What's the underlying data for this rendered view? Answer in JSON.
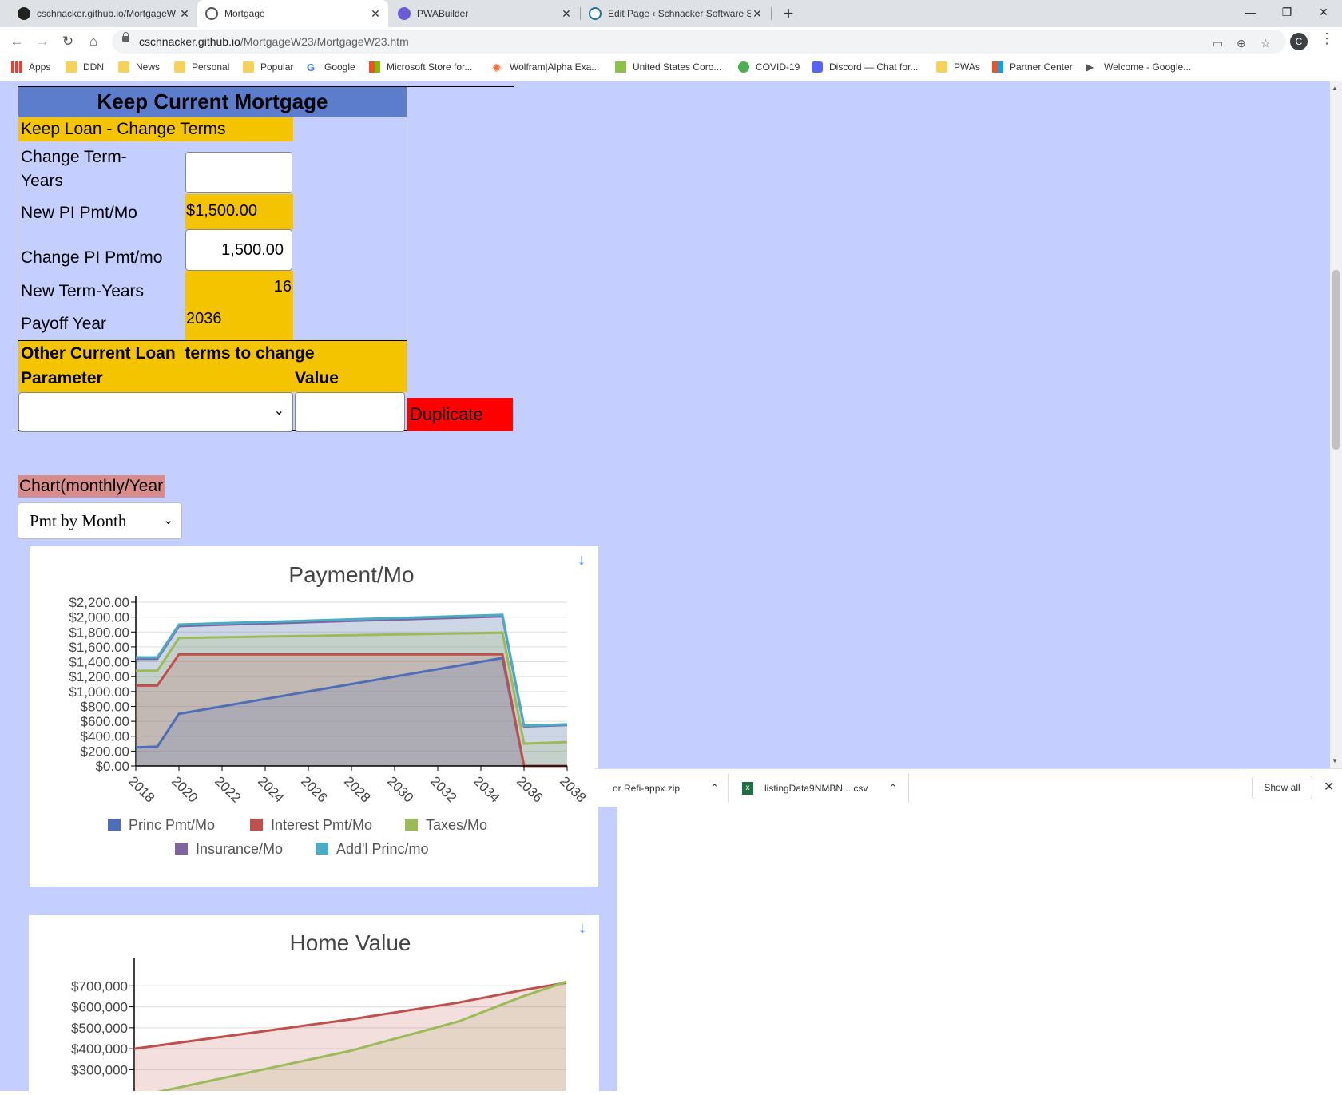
{
  "browser": {
    "tabs": [
      {
        "title": "cschnacker.github.io/MortgageW",
        "active": false
      },
      {
        "title": "Mortgage",
        "active": true
      },
      {
        "title": "PWABuilder",
        "active": false
      },
      {
        "title": "Edit Page ‹ Schnacker Software S",
        "active": false
      }
    ],
    "url_host": "cschnacker.github.io",
    "url_path": "/MortgageW23/MortgageW23.htm",
    "avatar_letter": "C",
    "bookmarks": [
      "Apps",
      "DDN",
      "News",
      "Personal",
      "Popular",
      "Google",
      "Microsoft Store for...",
      "Wolfram|Alpha Exa...",
      "United States Coro...",
      "COVID-19",
      "Discord — Chat for...",
      "PWAs",
      "Partner Center",
      "Welcome - Google..."
    ]
  },
  "panel": {
    "title": "Keep Current Mortgage",
    "subtitle": "Keep Loan - Change Terms",
    "change_term_label": "Change Term-\nYears",
    "change_term_value": "",
    "new_pi_label": "New PI Pmt/Mo",
    "new_pi_value": "$1,500.00",
    "change_pi_label": "Change PI Pmt/mo",
    "change_pi_value": "1,500.00",
    "new_term_label": "New Term-Years",
    "new_term_value": "16",
    "payoff_label": "Payoff Year",
    "payoff_value": "2036",
    "other_label": "Other Current Loan  terms to change",
    "param_header": "Parameter",
    "value_header": "Value",
    "param_selected": "",
    "value_input": "",
    "duplicate_label": "Duplicate"
  },
  "chart_controls": {
    "label": "Chart(monthly/Year",
    "selected": "Pmt by Month"
  },
  "chart_data": [
    {
      "type": "area",
      "title": "Payment/Mo",
      "x": [
        2018,
        2019,
        2020,
        2035,
        2036,
        2038
      ],
      "series": [
        {
          "name": "Princ Pmt/Mo",
          "color": "#4f6db8",
          "values": [
            250,
            260,
            700,
            1450,
            0,
            0
          ]
        },
        {
          "name": "Interest Pmt/Mo",
          "color": "#c0504d",
          "values": [
            1080,
            1080,
            1500,
            1500,
            0,
            0
          ]
        },
        {
          "name": "Taxes/Mo",
          "color": "#9bbb59",
          "values": [
            1280,
            1280,
            1720,
            1790,
            300,
            320
          ]
        },
        {
          "name": "Insurance/Mo",
          "color": "#8064a2",
          "values": [
            1440,
            1440,
            1880,
            2010,
            530,
            550
          ]
        },
        {
          "name": "Add'l Princ/mo",
          "color": "#4bacc6",
          "values": [
            1460,
            1460,
            1900,
            2030,
            540,
            560
          ]
        }
      ],
      "ylim": [
        0,
        2200
      ],
      "y_ticks": [
        "$0.00",
        "$200.00",
        "$400.00",
        "$600.00",
        "$800.00",
        "$1,000.00",
        "$1,200.00",
        "$1,400.00",
        "$1,600.00",
        "$1,800.00",
        "$2,000.00",
        "$2,200.00"
      ],
      "x_ticks": [
        "2018",
        "2020",
        "2022",
        "2024",
        "2026",
        "2028",
        "2030",
        "2032",
        "2034",
        "2036",
        "2038"
      ],
      "xlim": [
        2018,
        2038
      ],
      "legend": "bottom",
      "grid": true
    },
    {
      "type": "area",
      "title": "Home Value",
      "x": [
        2018,
        2023,
        2028,
        2033,
        2036,
        2038
      ],
      "series": [
        {
          "name": "",
          "color": "#c0504d",
          "values": [
            400000,
            470000,
            540000,
            620000,
            680000,
            715000
          ]
        },
        {
          "name": "",
          "color": "#9bbb59",
          "values": [
            170000,
            280000,
            390000,
            530000,
            650000,
            720000
          ]
        }
      ],
      "ylim": [
        100000,
        800000
      ],
      "y_ticks": [
        "$300,000",
        "$400,000",
        "$500,000",
        "$600,000",
        "$700,000"
      ],
      "xlim": [
        2018,
        2038
      ],
      "grid": true
    }
  ],
  "downloads": {
    "items": [
      "or Refi-appx.zip",
      "listingData9NMBN....csv"
    ],
    "show_all": "Show all"
  },
  "colors": {
    "page_bg": "#c5cfff",
    "yellow": "#f5c400",
    "header_blue": "#5b7dcb",
    "duplicate_red": "#ff0000"
  }
}
